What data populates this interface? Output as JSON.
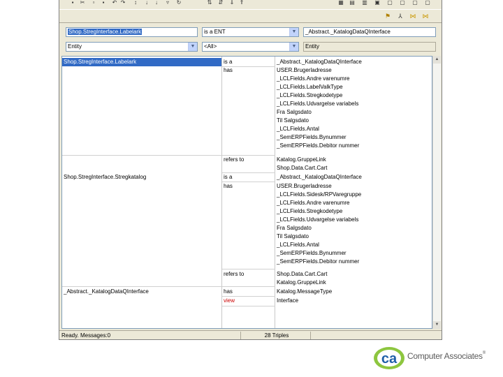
{
  "toolbar": {
    "top_icons": [
      "save-icon",
      "cut-icon",
      "copy-icon",
      "paste-icon",
      "undo-icon",
      "redo-icon",
      "sort-icon",
      "sort-asc-icon",
      "sort-desc-icon",
      "filter-icon",
      "refresh-icon"
    ],
    "right_icons": [
      "grid-icon",
      "list-icon",
      "tree-icon",
      "properties-icon",
      "help-icon"
    ],
    "row2_icons": [
      "flag-icon",
      "hierarchy-icon",
      "bowtie-icon",
      "relation-icon"
    ]
  },
  "query": {
    "subject_value": "Shop.StregInterface.Labelark",
    "predicate_value": "is a ENT",
    "object_value": "_Abstract._KatalogDataQInterface",
    "subject_type": "Entity",
    "predicate_filter": "<All>",
    "object_type": "Entity"
  },
  "grid": {
    "subjects": [
      {
        "label": "Shop.StregInterface.Labelark",
        "selected": true
      },
      {
        "label": "Shop.StregInterface.Stregkatalog",
        "selected": false
      },
      {
        "label": "_Abstract._KatalogDataQInterface",
        "selected": false
      }
    ],
    "predicates": [
      "is a",
      "has",
      "refers to",
      "is a",
      "has",
      "refers to",
      "has",
      "view"
    ],
    "objects": [
      "_Abstract._KatalogDataQInterface",
      "USER.Brugerladresse",
      "_LCLFields.Andre varenumre",
      "_LCLFields.LabelValkType",
      "_LCLFields.Stregkodetype",
      "_LCLFields.Udvargelse variabels",
      "Fra Salgsdato",
      "Til Salgsdato",
      "_LCLFields.Antal",
      "_SemERPFields.Bynummer",
      "_SemERPFields.Debitor nummer",
      "Katalog.GruppeLink",
      "Shop.Data.Cart.Cart",
      "_Abstract._KatalogDataQInterface",
      "USER.Brugerladresse",
      "_LCLFields.Sidesk/RPVaregruppe",
      "_LCLFields.Andre varenumre",
      "_LCLFields.Stregkodetype",
      "_LCLFields.Udvargelse variabels",
      "Fra Salgsdato",
      "Til Salgsdato",
      "_LCLFields.Antal",
      "_SemERPFields.Bynummer",
      "_SemERPFields.Debitor nummer",
      "Shop.Data.Cart.Cart",
      "Katalog.GruppeLink",
      "Katalog.MessageType",
      "Interface"
    ]
  },
  "status": {
    "message": "Ready. Messages:0",
    "triples": "28 Triples"
  },
  "logo": {
    "mark": "ca",
    "company": "Computer Associates",
    "trademark": "®"
  },
  "colors": {
    "selection": "#316ac5",
    "view_predicate": "#cc0000",
    "logo_green": "#8dc63f",
    "logo_blue": "#1f5fa8"
  }
}
